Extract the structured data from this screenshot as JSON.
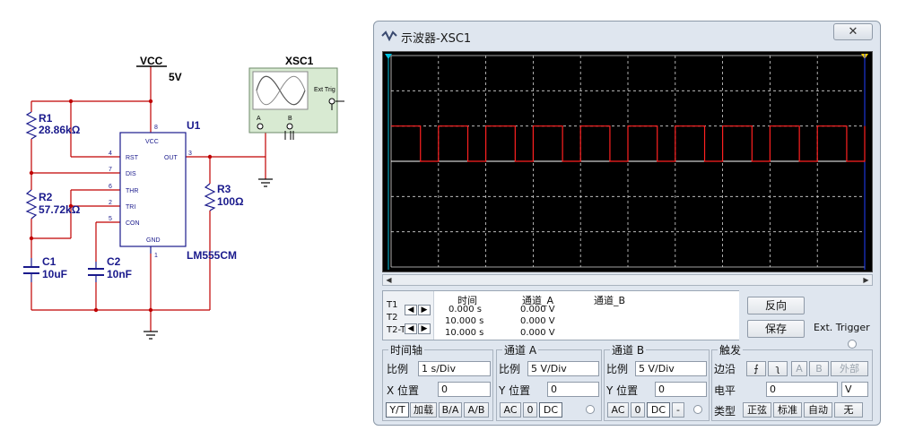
{
  "schematic": {
    "vcc_label": "VCC",
    "vcc_value": "5V",
    "r1_name": "R1",
    "r1_value": "28.86kΩ",
    "r2_name": "R2",
    "r2_value": "57.72kΩ",
    "r3_name": "R3",
    "r3_value": "100Ω",
    "c1_name": "C1",
    "c1_value": "10uF",
    "c2_name": "C2",
    "c2_value": "10nF",
    "u1_name": "U1",
    "u1_part": "LM555CM",
    "pins": {
      "vcc": "VCC",
      "rst": "RST",
      "dis": "DIS",
      "thr": "THR",
      "tri": "TRI",
      "con": "CON",
      "out": "OUT",
      "gnd": "GND",
      "n8": "8",
      "n4": "4",
      "n7": "7",
      "n6": "6",
      "n2": "2",
      "n5": "5",
      "n3": "3",
      "n1": "1"
    },
    "xsc_label": "XSC1",
    "xsc_ext": "Ext Trig",
    "xsc_a": "A",
    "xsc_b": "B",
    "colors": {
      "wire": "#c00000",
      "label": "#1a1a8c",
      "black": "#000000"
    }
  },
  "window": {
    "title": "示波器-XSC1",
    "close_glyph": "✕",
    "waveform": {
      "channel": "A",
      "color": "#ff2020",
      "low_level_div": 0,
      "high_level_div": 1,
      "baseline_color": "#ffffff",
      "cycles_on_screen": 10
    }
  },
  "readout": {
    "t1_label": "T1",
    "t2_label": "T2",
    "t21_label": "T2-T1",
    "headers": {
      "time": "时间",
      "chA": "通道_A",
      "chB": "通道_B"
    },
    "rows": [
      {
        "time": "0.000 s",
        "chA": "0.000 V"
      },
      {
        "time": "10.000 s",
        "chA": "0.000 V"
      },
      {
        "time": "10.000 s",
        "chA": "0.000 V"
      }
    ]
  },
  "side": {
    "reverse": "反向",
    "save": "保存",
    "ext_trigger": "Ext. Trigger"
  },
  "timebase": {
    "title": "时间轴",
    "scale_label": "比例",
    "scale_value": "1 s/Div",
    "xpos_label": "X 位置",
    "xpos_value": "0",
    "modes": [
      "Y/T",
      "加载",
      "B/A",
      "A/B"
    ]
  },
  "chA": {
    "title": "通道 A",
    "scale_label": "比例",
    "scale_value": "5 V/Div",
    "ypos_label": "Y 位置",
    "ypos_value": "0",
    "coupling": [
      "AC",
      "0",
      "DC"
    ]
  },
  "chB": {
    "title": "通道 B",
    "scale_label": "比例",
    "scale_value": "5 V/Div",
    "ypos_label": "Y 位置",
    "ypos_value": "0",
    "coupling": [
      "AC",
      "0",
      "DC",
      "-"
    ]
  },
  "trigger": {
    "title": "触发",
    "edge_label": "边沿",
    "level_label": "电平",
    "level_value": "0",
    "level_unit": "V",
    "sources": [
      "A",
      "B",
      "外部"
    ],
    "type_label": "类型",
    "types": [
      "正弦",
      "标准",
      "自动",
      "无"
    ]
  }
}
